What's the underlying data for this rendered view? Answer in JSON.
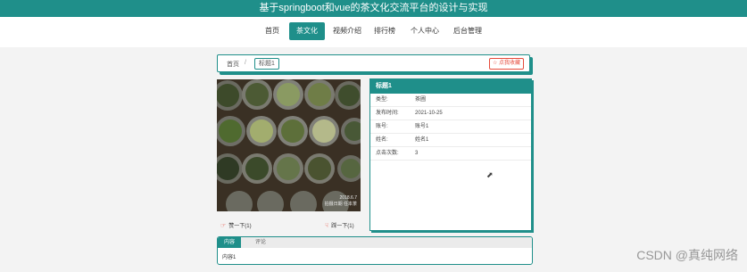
{
  "header": {
    "title": "基于springboot和vue的茶文化交流平台的设计与实现"
  },
  "nav": {
    "items": [
      {
        "label": "首页",
        "active": false
      },
      {
        "label": "茶文化",
        "active": true
      },
      {
        "label": "视频介绍",
        "active": false
      },
      {
        "label": "排行榜",
        "active": false
      },
      {
        "label": "个人中心",
        "active": false
      },
      {
        "label": "后台管理",
        "active": false
      }
    ]
  },
  "breadcrumb": {
    "home": "首页",
    "separator": "/",
    "current": "标题1",
    "favorite": "☆ 点我收藏"
  },
  "image": {
    "caption_date": "2018.6.7",
    "caption_text": "拍摄日期 任本茶"
  },
  "votes": {
    "up": "赞一下(1)",
    "down": "踩一下(1)"
  },
  "detail": {
    "title": "标题1",
    "rows": [
      {
        "key": "类型:",
        "value": "茶圃"
      },
      {
        "key": "发布时间:",
        "value": "2021-10-25"
      },
      {
        "key": "账号:",
        "value": "账号1"
      },
      {
        "key": "姓名:",
        "value": "姓名1"
      },
      {
        "key": "点击次数:",
        "value": "3"
      }
    ]
  },
  "tabs": {
    "items": [
      "内容",
      "评论"
    ],
    "content": "内容1"
  },
  "watermark": "CSDN @真纯网络",
  "colors": {
    "accent": "#1f8f8a",
    "danger": "#e64a3b"
  }
}
